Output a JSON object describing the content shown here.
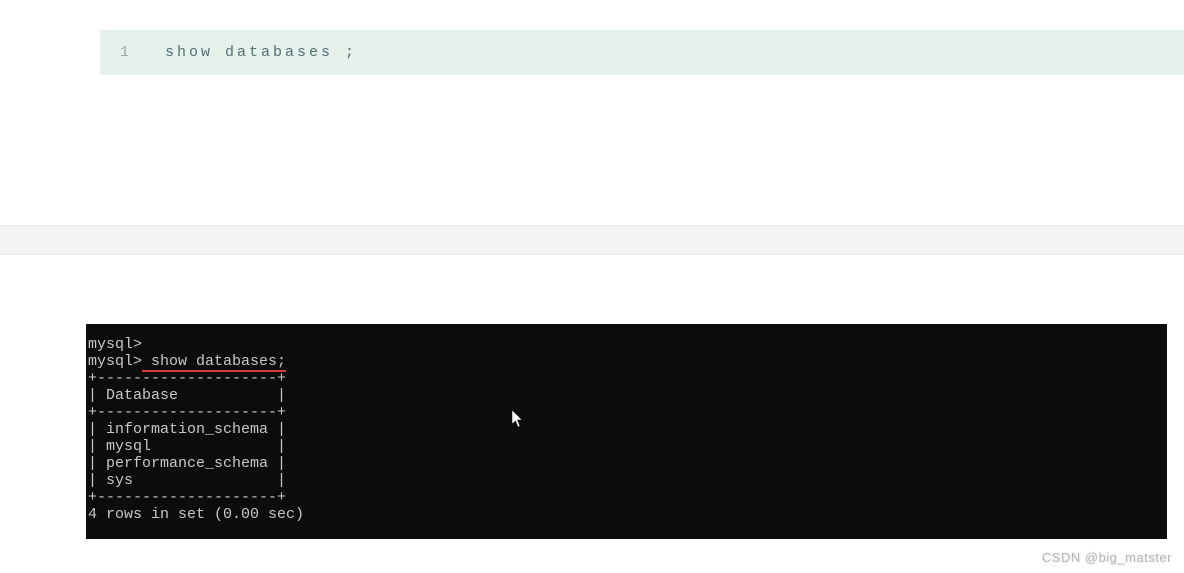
{
  "code_block": {
    "line_number": "1",
    "code": "show databases ;"
  },
  "terminal": {
    "prompt1": "mysql>",
    "prompt2": "mysql>",
    "command_highlighted": " show databases;",
    "divider1": "+--------------------+",
    "header_left": "| ",
    "header_text": "Database",
    "header_right": "           |",
    "divider2": "+--------------------+",
    "rows": [
      "| information_schema |",
      "| mysql              |",
      "| performance_schema |",
      "| sys                |"
    ],
    "divider3": "+--------------------+",
    "result_line": "4 rows in set (0.00 sec)"
  },
  "watermark": "CSDN @big_matster"
}
